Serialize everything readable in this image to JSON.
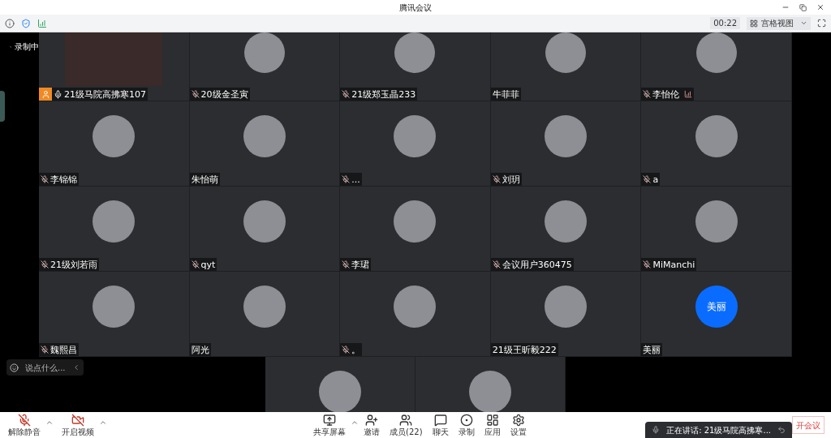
{
  "window": {
    "title": "腾讯会议"
  },
  "toolbar": {
    "timer": "00:22",
    "view_button": "宫格视图"
  },
  "recording": {
    "label": "录制中"
  },
  "tiles": [
    {
      "kind": "video",
      "name": "21级马院高拂寒107",
      "mic_icon": true,
      "muted": false,
      "host": true,
      "signal": false
    },
    {
      "kind": "avatar",
      "name": "20级金圣寅",
      "mic_icon": true,
      "muted": true,
      "host": false,
      "signal": false
    },
    {
      "kind": "avatar",
      "name": "21级郑玉晶233",
      "mic_icon": true,
      "muted": true,
      "host": false,
      "signal": false
    },
    {
      "kind": "avatar",
      "name": "牛菲菲",
      "mic_icon": false,
      "host": false,
      "signal": false
    },
    {
      "kind": "avatar",
      "name": "李怡伦",
      "mic_icon": true,
      "muted": true,
      "host": false,
      "signal": true
    },
    {
      "kind": "avatar",
      "name": "李锦锦",
      "mic_icon": true,
      "muted": true,
      "host": false,
      "signal": false
    },
    {
      "kind": "avatar",
      "name": "朱怡萌",
      "mic_icon": false,
      "host": false,
      "signal": false
    },
    {
      "kind": "avatar",
      "name": "...",
      "mic_icon": true,
      "muted": true,
      "host": false,
      "signal": false
    },
    {
      "kind": "avatar",
      "name": "刘玥",
      "mic_icon": true,
      "muted": true,
      "host": false,
      "signal": false
    },
    {
      "kind": "avatar",
      "name": "a",
      "mic_icon": true,
      "muted": true,
      "host": false,
      "signal": false
    },
    {
      "kind": "avatar",
      "name": "21级刘若雨",
      "mic_icon": true,
      "muted": true,
      "host": false,
      "signal": false
    },
    {
      "kind": "avatar",
      "name": "qyt",
      "mic_icon": true,
      "muted": true,
      "host": false,
      "signal": false
    },
    {
      "kind": "avatar",
      "name": "李珺",
      "mic_icon": true,
      "muted": true,
      "host": false,
      "signal": false
    },
    {
      "kind": "avatar",
      "name": "会议用户360475",
      "mic_icon": true,
      "muted": true,
      "host": false,
      "signal": false
    },
    {
      "kind": "avatar",
      "name": "MiManchi",
      "mic_icon": true,
      "muted": true,
      "host": false,
      "signal": false
    },
    {
      "kind": "avatar",
      "name": "魏熙昌",
      "mic_icon": true,
      "muted": true,
      "host": false,
      "signal": false
    },
    {
      "kind": "avatar",
      "name": "阿光",
      "mic_icon": false,
      "host": false,
      "signal": false
    },
    {
      "kind": "avatar",
      "name": "。",
      "mic_icon": true,
      "muted": true,
      "host": false,
      "signal": false
    },
    {
      "kind": "avatar",
      "name": "21级王昕毅222",
      "mic_icon": false,
      "host": false,
      "signal": false
    },
    {
      "kind": "text_avatar",
      "avatar_text": "美丽",
      "name": "美丽",
      "mic_icon": false,
      "host": false,
      "signal": false
    }
  ],
  "bottom_tiles": [
    {
      "kind": "avatar"
    },
    {
      "kind": "avatar"
    }
  ],
  "chat": {
    "placeholder": "说点什么..."
  },
  "left_controls": [
    {
      "kind": "mic_off",
      "label": "解除静音",
      "caret": true
    },
    {
      "kind": "video_off",
      "label": "开启视频",
      "caret": true
    }
  ],
  "center_controls": [
    {
      "kind": "share",
      "label": "共享屏幕",
      "caret": true
    },
    {
      "kind": "invite",
      "label": "邀请",
      "caret": false
    },
    {
      "kind": "members",
      "label": "成员(22)",
      "caret": false
    },
    {
      "kind": "chat",
      "label": "聊天",
      "caret": false
    },
    {
      "kind": "record",
      "label": "录制",
      "caret": false
    },
    {
      "kind": "apps",
      "label": "应用",
      "caret": false
    },
    {
      "kind": "settings",
      "label": "设置",
      "caret": false
    }
  ],
  "speaking": {
    "text": "正在讲话: 21级马院高拂寒..."
  },
  "leave_button": {
    "label": "开会议"
  }
}
